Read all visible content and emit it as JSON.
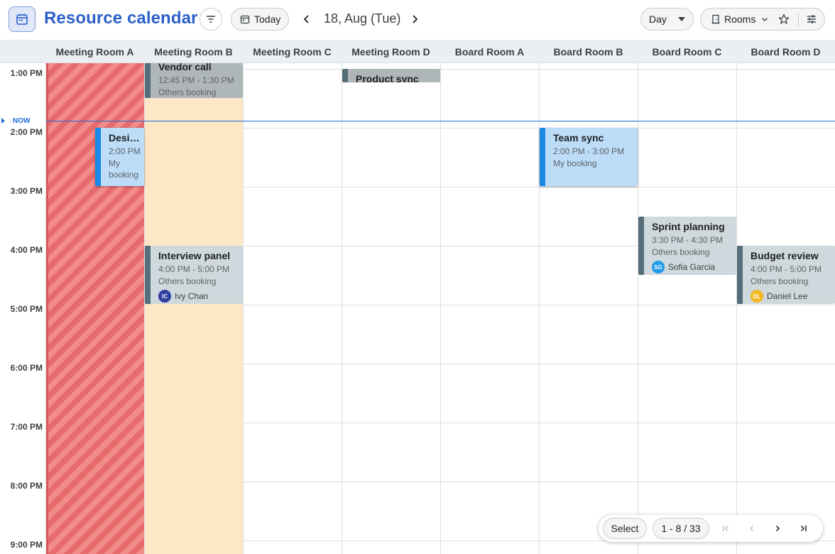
{
  "app": {
    "title": "Resource calendar",
    "icon": "calendar-icon"
  },
  "toolbar": {
    "today_label": "Today",
    "date_label": "18, Aug (Tue)",
    "view_label": "Day",
    "resource_label": "Rooms"
  },
  "rooms": [
    "Meeting Room A",
    "Meeting Room B",
    "Meeting Room C",
    "Meeting Room D",
    "Board Room A",
    "Board Room B",
    "Board Room C",
    "Board Room D"
  ],
  "times": [
    "1:00 PM",
    "2:00 PM",
    "3:00 PM",
    "4:00 PM",
    "5:00 PM",
    "6:00 PM",
    "7:00 PM",
    "8:00 PM",
    "9:00 PM"
  ],
  "now_label": "NOW",
  "events": {
    "vendor_call": {
      "title": "Vendor call",
      "time": "12:45 PM - 1:30 PM",
      "sub": "Others booking"
    },
    "product_sync": {
      "title": "Product sync"
    },
    "design": {
      "title": "Design review",
      "time": "2:00 PM",
      "sub": "My booking"
    },
    "team_sync": {
      "title": "Team sync",
      "time": "2:00 PM - 3:00 PM",
      "sub": "My booking"
    },
    "sprint": {
      "title": "Sprint planning",
      "time": "3:30 PM - 4:30 PM",
      "sub": "Others booking",
      "initials": "SG",
      "person": "Sofia Garcia",
      "avatar_color": "#1e9be9"
    },
    "interview": {
      "title": "Interview panel",
      "time": "4:00 PM - 5:00 PM",
      "sub": "Others booking",
      "initials": "IC",
      "person": "Ivy Chan",
      "avatar_color": "#2f3f9e"
    },
    "budget": {
      "title": "Budget review",
      "time": "4:00 PM - 5:00 PM",
      "sub": "Others booking",
      "initials": "DL",
      "person": "Daniel Lee",
      "avatar_color": "#f2b81f"
    }
  },
  "pager": {
    "select_label": "Select",
    "range_label": "1 - 8 / 33"
  },
  "colors": {
    "accent": "#2c61c9",
    "now": "#1f6cd3",
    "my_booking": "#1e88e5",
    "others_booking": "#546e7a"
  }
}
